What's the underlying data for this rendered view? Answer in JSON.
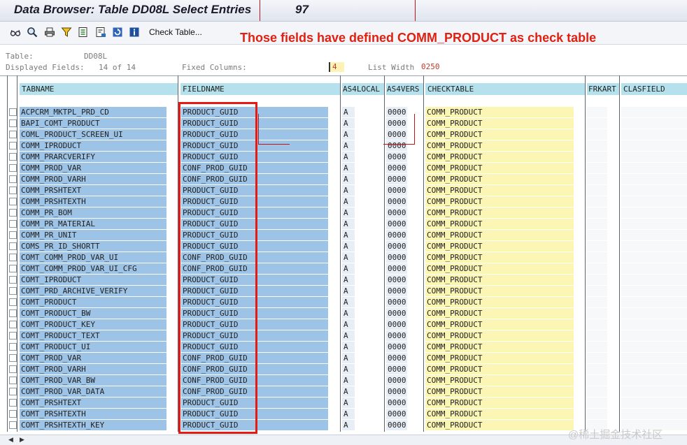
{
  "window": {
    "title": "Data Browser: Table DD08L Select Entries",
    "count": "97"
  },
  "toolbar": {
    "check_table_label": "Check Table..."
  },
  "annotation": "Those fields have defined COMM_PRODUCT as check table",
  "info": {
    "table_label": "Table:",
    "table_value": "DD08L",
    "displayed_label": "Displayed Fields:",
    "displayed_value": "14 of 14",
    "fixed_label": "Fixed Columns:",
    "fixed_value": "4",
    "listwidth_label": "List Width",
    "listwidth_value": "0250"
  },
  "columns": [
    "TABNAME",
    "FIELDNAME",
    "AS4LOCAL",
    "AS4VERS",
    "CHECKTABLE",
    "FRKART",
    "CLASFIELD"
  ],
  "rows": [
    {
      "tabname": "ACPCRM_MKTPL_PRD_CD",
      "fieldname": "PRODUCT_GUID",
      "as4local": "A",
      "as4vers": "0000",
      "checktable": "COMM_PRODUCT"
    },
    {
      "tabname": "BAPI_COMT_PRODUCT",
      "fieldname": "PRODUCT_GUID",
      "as4local": "A",
      "as4vers": "0000",
      "checktable": "COMM_PRODUCT"
    },
    {
      "tabname": "COML_PRODUCT_SCREEN_UI",
      "fieldname": "PRODUCT_GUID",
      "as4local": "A",
      "as4vers": "0000",
      "checktable": "COMM_PRODUCT"
    },
    {
      "tabname": "COMM_IPRODUCT",
      "fieldname": "PRODUCT_GUID",
      "as4local": "A",
      "as4vers": "0000",
      "checktable": "COMM_PRODUCT"
    },
    {
      "tabname": "COMM_PRARCVERIFY",
      "fieldname": "PRODUCT_GUID",
      "as4local": "A",
      "as4vers": "0000",
      "checktable": "COMM_PRODUCT"
    },
    {
      "tabname": "COMM_PROD_VAR",
      "fieldname": "CONF_PROD_GUID",
      "as4local": "A",
      "as4vers": "0000",
      "checktable": "COMM_PRODUCT"
    },
    {
      "tabname": "COMM_PROD_VARH",
      "fieldname": "CONF_PROD_GUID",
      "as4local": "A",
      "as4vers": "0000",
      "checktable": "COMM_PRODUCT"
    },
    {
      "tabname": "COMM_PRSHTEXT",
      "fieldname": "PRODUCT_GUID",
      "as4local": "A",
      "as4vers": "0000",
      "checktable": "COMM_PRODUCT"
    },
    {
      "tabname": "COMM_PRSHTEXTH",
      "fieldname": "PRODUCT_GUID",
      "as4local": "A",
      "as4vers": "0000",
      "checktable": "COMM_PRODUCT"
    },
    {
      "tabname": "COMM_PR_BOM",
      "fieldname": "PRODUCT_GUID",
      "as4local": "A",
      "as4vers": "0000",
      "checktable": "COMM_PRODUCT"
    },
    {
      "tabname": "COMM_PR_MATERIAL",
      "fieldname": "PRODUCT_GUID",
      "as4local": "A",
      "as4vers": "0000",
      "checktable": "COMM_PRODUCT"
    },
    {
      "tabname": "COMM_PR_UNIT",
      "fieldname": "PRODUCT_GUID",
      "as4local": "A",
      "as4vers": "0000",
      "checktable": "COMM_PRODUCT"
    },
    {
      "tabname": "COMS_PR_ID_SHORTT",
      "fieldname": "PRODUCT_GUID",
      "as4local": "A",
      "as4vers": "0000",
      "checktable": "COMM_PRODUCT"
    },
    {
      "tabname": "COMT_COMM_PROD_VAR_UI",
      "fieldname": "CONF_PROD_GUID",
      "as4local": "A",
      "as4vers": "0000",
      "checktable": "COMM_PRODUCT"
    },
    {
      "tabname": "COMT_COMM_PROD_VAR_UI_CFG",
      "fieldname": "CONF_PROD_GUID",
      "as4local": "A",
      "as4vers": "0000",
      "checktable": "COMM_PRODUCT"
    },
    {
      "tabname": "COMT_IPRODUCT",
      "fieldname": "PRODUCT_GUID",
      "as4local": "A",
      "as4vers": "0000",
      "checktable": "COMM_PRODUCT"
    },
    {
      "tabname": "COMT_PRD_ARCHIVE_VERIFY",
      "fieldname": "PRODUCT_GUID",
      "as4local": "A",
      "as4vers": "0000",
      "checktable": "COMM_PRODUCT"
    },
    {
      "tabname": "COMT_PRODUCT",
      "fieldname": "PRODUCT_GUID",
      "as4local": "A",
      "as4vers": "0000",
      "checktable": "COMM_PRODUCT"
    },
    {
      "tabname": "COMT_PRODUCT_BW",
      "fieldname": "PRODUCT_GUID",
      "as4local": "A",
      "as4vers": "0000",
      "checktable": "COMM_PRODUCT"
    },
    {
      "tabname": "COMT_PRODUCT_KEY",
      "fieldname": "PRODUCT_GUID",
      "as4local": "A",
      "as4vers": "0000",
      "checktable": "COMM_PRODUCT"
    },
    {
      "tabname": "COMT_PRODUCT_TEXT",
      "fieldname": "PRODUCT_GUID",
      "as4local": "A",
      "as4vers": "0000",
      "checktable": "COMM_PRODUCT"
    },
    {
      "tabname": "COMT_PRODUCT_UI",
      "fieldname": "PRODUCT_GUID",
      "as4local": "A",
      "as4vers": "0000",
      "checktable": "COMM_PRODUCT"
    },
    {
      "tabname": "COMT_PROD_VAR",
      "fieldname": "CONF_PROD_GUID",
      "as4local": "A",
      "as4vers": "0000",
      "checktable": "COMM_PRODUCT"
    },
    {
      "tabname": "COMT_PROD_VARH",
      "fieldname": "CONF_PROD_GUID",
      "as4local": "A",
      "as4vers": "0000",
      "checktable": "COMM_PRODUCT"
    },
    {
      "tabname": "COMT_PROD_VAR_BW",
      "fieldname": "CONF_PROD_GUID",
      "as4local": "A",
      "as4vers": "0000",
      "checktable": "COMM_PRODUCT"
    },
    {
      "tabname": "COMT_PROD_VAR_DATA",
      "fieldname": "CONF_PROD_GUID",
      "as4local": "A",
      "as4vers": "0000",
      "checktable": "COMM_PRODUCT"
    },
    {
      "tabname": "COMT_PRSHTEXT",
      "fieldname": "PRODUCT_GUID",
      "as4local": "A",
      "as4vers": "0000",
      "checktable": "COMM_PRODUCT"
    },
    {
      "tabname": "COMT_PRSHTEXTH",
      "fieldname": "PRODUCT_GUID",
      "as4local": "A",
      "as4vers": "0000",
      "checktable": "COMM_PRODUCT"
    },
    {
      "tabname": "COMT_PRSHTEXTH_KEY",
      "fieldname": "PRODUCT_GUID",
      "as4local": "A",
      "as4vers": "0000",
      "checktable": "COMM_PRODUCT"
    }
  ],
  "watermark": "@稀土掘金技术社区",
  "icons": [
    "glasses-icon",
    "detail-icon",
    "print-icon",
    "filter-icon",
    "export-icon",
    "settings-icon",
    "refresh-icon",
    "info-icon"
  ],
  "colors": {
    "annotation": "#e02010",
    "header_bg": "#b5e1ec",
    "key_cell_bg": "#9dc3e6",
    "checktable_bg": "#fbf6b3"
  }
}
